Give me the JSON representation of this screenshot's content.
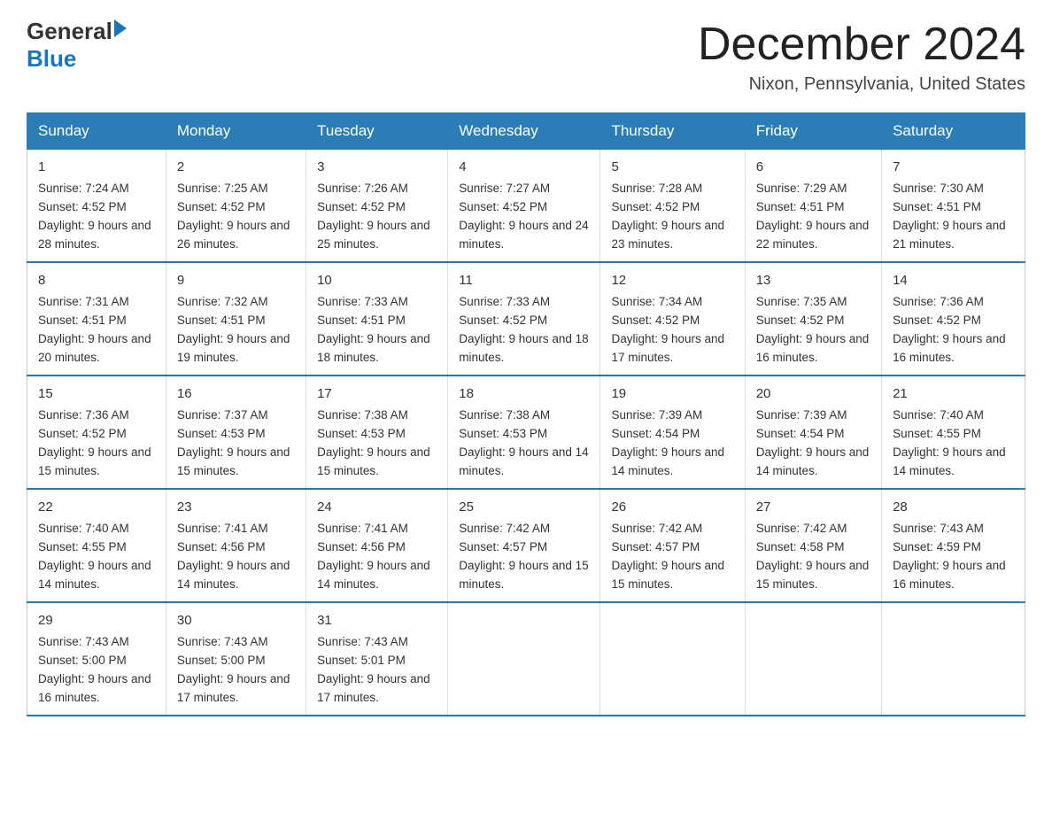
{
  "logo": {
    "general": "General",
    "blue": "Blue"
  },
  "title": "December 2024",
  "subtitle": "Nixon, Pennsylvania, United States",
  "headers": [
    "Sunday",
    "Monday",
    "Tuesday",
    "Wednesday",
    "Thursday",
    "Friday",
    "Saturday"
  ],
  "weeks": [
    [
      {
        "day": "1",
        "sunrise": "7:24 AM",
        "sunset": "4:52 PM",
        "daylight": "9 hours and 28 minutes."
      },
      {
        "day": "2",
        "sunrise": "7:25 AM",
        "sunset": "4:52 PM",
        "daylight": "9 hours and 26 minutes."
      },
      {
        "day": "3",
        "sunrise": "7:26 AM",
        "sunset": "4:52 PM",
        "daylight": "9 hours and 25 minutes."
      },
      {
        "day": "4",
        "sunrise": "7:27 AM",
        "sunset": "4:52 PM",
        "daylight": "9 hours and 24 minutes."
      },
      {
        "day": "5",
        "sunrise": "7:28 AM",
        "sunset": "4:52 PM",
        "daylight": "9 hours and 23 minutes."
      },
      {
        "day": "6",
        "sunrise": "7:29 AM",
        "sunset": "4:51 PM",
        "daylight": "9 hours and 22 minutes."
      },
      {
        "day": "7",
        "sunrise": "7:30 AM",
        "sunset": "4:51 PM",
        "daylight": "9 hours and 21 minutes."
      }
    ],
    [
      {
        "day": "8",
        "sunrise": "7:31 AM",
        "sunset": "4:51 PM",
        "daylight": "9 hours and 20 minutes."
      },
      {
        "day": "9",
        "sunrise": "7:32 AM",
        "sunset": "4:51 PM",
        "daylight": "9 hours and 19 minutes."
      },
      {
        "day": "10",
        "sunrise": "7:33 AM",
        "sunset": "4:51 PM",
        "daylight": "9 hours and 18 minutes."
      },
      {
        "day": "11",
        "sunrise": "7:33 AM",
        "sunset": "4:52 PM",
        "daylight": "9 hours and 18 minutes."
      },
      {
        "day": "12",
        "sunrise": "7:34 AM",
        "sunset": "4:52 PM",
        "daylight": "9 hours and 17 minutes."
      },
      {
        "day": "13",
        "sunrise": "7:35 AM",
        "sunset": "4:52 PM",
        "daylight": "9 hours and 16 minutes."
      },
      {
        "day": "14",
        "sunrise": "7:36 AM",
        "sunset": "4:52 PM",
        "daylight": "9 hours and 16 minutes."
      }
    ],
    [
      {
        "day": "15",
        "sunrise": "7:36 AM",
        "sunset": "4:52 PM",
        "daylight": "9 hours and 15 minutes."
      },
      {
        "day": "16",
        "sunrise": "7:37 AM",
        "sunset": "4:53 PM",
        "daylight": "9 hours and 15 minutes."
      },
      {
        "day": "17",
        "sunrise": "7:38 AM",
        "sunset": "4:53 PM",
        "daylight": "9 hours and 15 minutes."
      },
      {
        "day": "18",
        "sunrise": "7:38 AM",
        "sunset": "4:53 PM",
        "daylight": "9 hours and 14 minutes."
      },
      {
        "day": "19",
        "sunrise": "7:39 AM",
        "sunset": "4:54 PM",
        "daylight": "9 hours and 14 minutes."
      },
      {
        "day": "20",
        "sunrise": "7:39 AM",
        "sunset": "4:54 PM",
        "daylight": "9 hours and 14 minutes."
      },
      {
        "day": "21",
        "sunrise": "7:40 AM",
        "sunset": "4:55 PM",
        "daylight": "9 hours and 14 minutes."
      }
    ],
    [
      {
        "day": "22",
        "sunrise": "7:40 AM",
        "sunset": "4:55 PM",
        "daylight": "9 hours and 14 minutes."
      },
      {
        "day": "23",
        "sunrise": "7:41 AM",
        "sunset": "4:56 PM",
        "daylight": "9 hours and 14 minutes."
      },
      {
        "day": "24",
        "sunrise": "7:41 AM",
        "sunset": "4:56 PM",
        "daylight": "9 hours and 14 minutes."
      },
      {
        "day": "25",
        "sunrise": "7:42 AM",
        "sunset": "4:57 PM",
        "daylight": "9 hours and 15 minutes."
      },
      {
        "day": "26",
        "sunrise": "7:42 AM",
        "sunset": "4:57 PM",
        "daylight": "9 hours and 15 minutes."
      },
      {
        "day": "27",
        "sunrise": "7:42 AM",
        "sunset": "4:58 PM",
        "daylight": "9 hours and 15 minutes."
      },
      {
        "day": "28",
        "sunrise": "7:43 AM",
        "sunset": "4:59 PM",
        "daylight": "9 hours and 16 minutes."
      }
    ],
    [
      {
        "day": "29",
        "sunrise": "7:43 AM",
        "sunset": "5:00 PM",
        "daylight": "9 hours and 16 minutes."
      },
      {
        "day": "30",
        "sunrise": "7:43 AM",
        "sunset": "5:00 PM",
        "daylight": "9 hours and 17 minutes."
      },
      {
        "day": "31",
        "sunrise": "7:43 AM",
        "sunset": "5:01 PM",
        "daylight": "9 hours and 17 minutes."
      },
      {
        "day": "",
        "sunrise": "",
        "sunset": "",
        "daylight": ""
      },
      {
        "day": "",
        "sunrise": "",
        "sunset": "",
        "daylight": ""
      },
      {
        "day": "",
        "sunrise": "",
        "sunset": "",
        "daylight": ""
      },
      {
        "day": "",
        "sunrise": "",
        "sunset": "",
        "daylight": ""
      }
    ]
  ],
  "labels": {
    "sunrise": "Sunrise:",
    "sunset": "Sunset:",
    "daylight": "Daylight:"
  }
}
